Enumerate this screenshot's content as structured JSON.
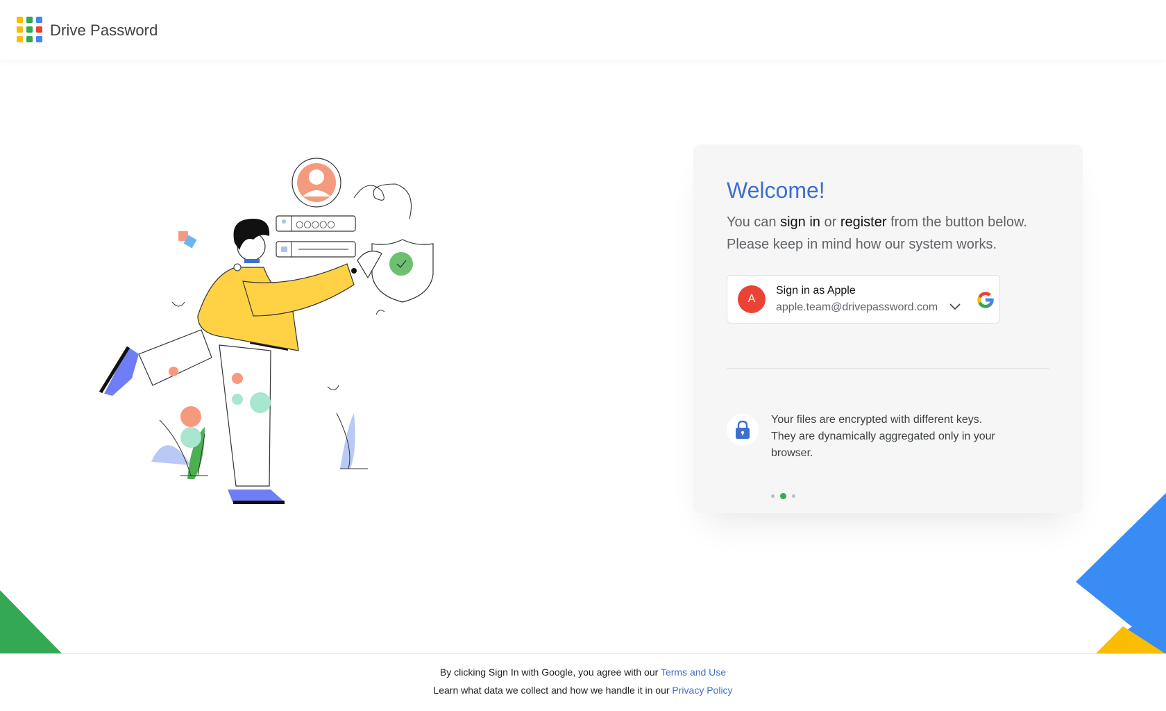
{
  "header": {
    "app_name": "Drive Password"
  },
  "card": {
    "welcome": "Welcome!",
    "intro": {
      "prefix": "You can ",
      "sign_in": "sign in",
      "or": " or ",
      "register": "register",
      "suffix": " from the button below.",
      "line2": "Please keep in mind how our system works."
    },
    "signin_button": {
      "avatar_letter": "A",
      "title": "Sign in as Apple",
      "email": "apple.team@drivepassword.com",
      "provider_icon": "google-g-icon"
    },
    "feature": {
      "icon": "lock-icon",
      "text": "Your files are encrypted with different keys. They are dynamically aggregated only in your browser."
    },
    "carousel": {
      "count": 3,
      "active_index": 1
    }
  },
  "footer": {
    "line1_text": "By clicking Sign In with Google, you agree with our ",
    "terms_link": "Terms and Use",
    "line2_text": "Learn what data we collect and how we handle it in our ",
    "privacy_link": "Privacy Policy"
  },
  "illustration": {
    "password_field_mask": "○○○○○"
  },
  "colors": {
    "brand_blue": "#3d6fcf",
    "google_red": "#ea4335",
    "google_green": "#34a853",
    "google_yellow": "#fbbc04",
    "google_blue": "#4285f4",
    "corner_blue": "#3a8cf5",
    "corner_green": "#35a853",
    "corner_yellow": "#fbbc04"
  }
}
